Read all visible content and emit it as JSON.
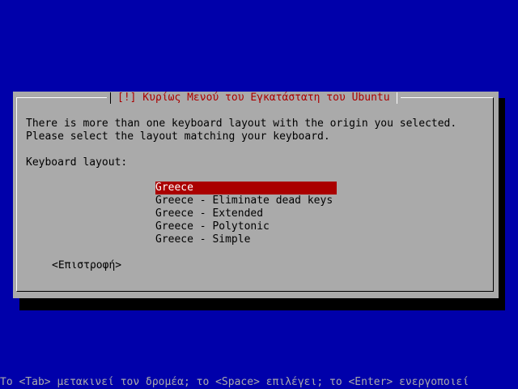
{
  "dialog": {
    "title": "[!] Κυρίως Μενού του Εγκατάστατη του Ubuntu",
    "line1": "There is more than one keyboard layout with the origin you selected.",
    "line2": "Please select the layout matching your keyboard.",
    "prompt": "Keyboard layout:",
    "options": [
      "Greece",
      "Greece - Eliminate dead keys",
      "Greece - Extended",
      "Greece - Polytonic",
      "Greece - Simple"
    ],
    "selected_index": 0,
    "back_label": "<Επιστροφή>"
  },
  "statusbar": {
    "text": "Το <Tab> μετακινεί τον δρομέα; το <Space> επιλέγει; το <Enter> ενεργοποιεί"
  },
  "colors": {
    "background": "#0000aa",
    "dialog": "#aaaaaa",
    "accent": "#aa0000",
    "selected_text": "#ffffff",
    "shadow": "#000000"
  }
}
